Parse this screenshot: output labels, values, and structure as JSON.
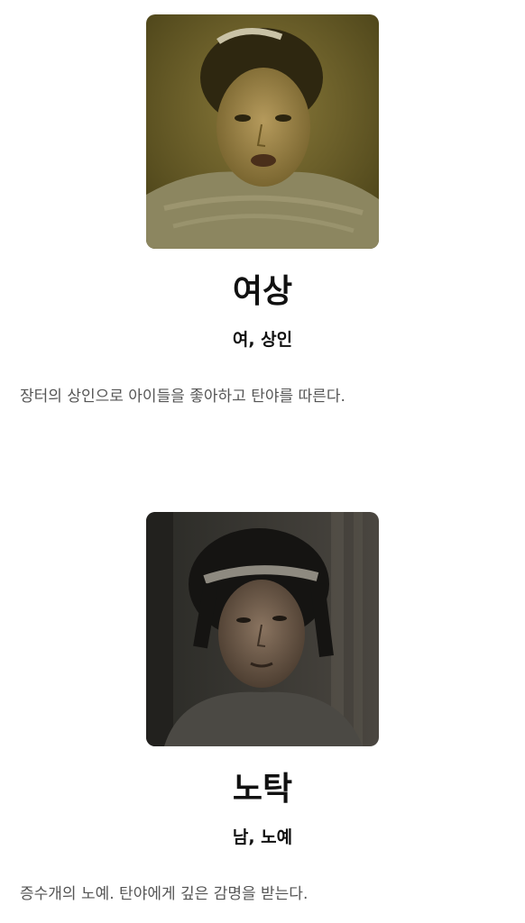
{
  "characters": [
    {
      "name": "여상",
      "role": "여, 상인",
      "description": "장터의 상인으로 아이들을 좋아하고 탄야를 따른다.",
      "image_icon": "portrait-woman-merchant"
    },
    {
      "name": "노탁",
      "role": "남, 노예",
      "description": "증수개의 노예. 탄야에게 깊은 감명을 받는다.",
      "image_icon": "portrait-boy-slave"
    }
  ],
  "colors": {
    "background": "#ffffff",
    "name_text": "#111111",
    "description_text": "#555555"
  }
}
